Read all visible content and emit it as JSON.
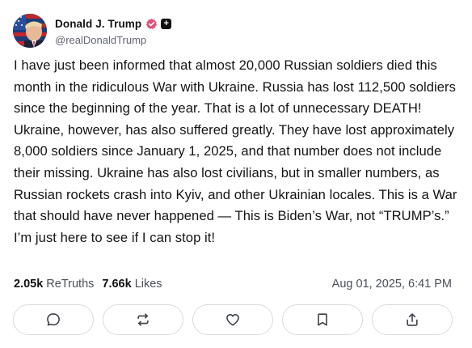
{
  "author": {
    "display_name": "Donald J. Trump",
    "handle": "@realDonaldTrump",
    "verified_icon": "verified-badge-icon",
    "plus_badge": "+"
  },
  "post": {
    "text": "I have just been informed that almost 20,000 Russian soldiers died this month in the ridiculous War with Ukraine. Russia has lost 112,500 soldiers since the beginning of the year. That is a lot of unnecessary DEATH! Ukraine, however, has also suffered greatly. They have lost approximately 8,000 soldiers since January 1, 2025, and that number does not include their missing. Ukraine has also lost civilians, but in smaller numbers, as Russian rockets crash into Kyiv, and other Ukrainian locales. This is a War that should have never happened — This is Biden’s War, not “TRUMP’s.” I’m just here to see if I can stop it!"
  },
  "stats": {
    "retruths_count": "2.05k",
    "retruths_label": "ReTruths",
    "likes_count": "7.66k",
    "likes_label": "Likes"
  },
  "timestamp": "Aug 01, 2025, 6:41 PM",
  "actions": [
    {
      "name": "reply",
      "icon": "comment-icon"
    },
    {
      "name": "retruth",
      "icon": "retruth-icon"
    },
    {
      "name": "like",
      "icon": "heart-icon"
    },
    {
      "name": "bookmark",
      "icon": "bookmark-icon"
    },
    {
      "name": "share",
      "icon": "share-icon"
    }
  ],
  "colors": {
    "verified_badge": "#e0517b",
    "text": "#141414",
    "muted": "#4a4f58",
    "border": "#d9dbe0"
  }
}
